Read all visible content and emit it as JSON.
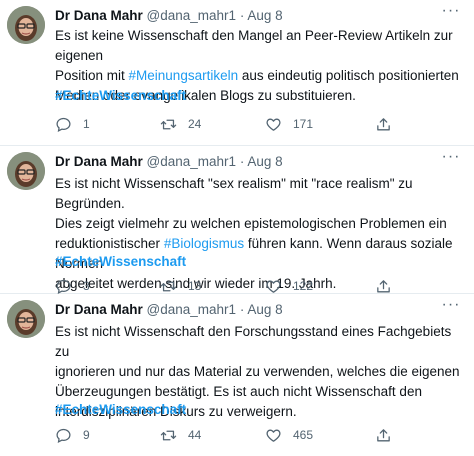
{
  "tweets": [
    {
      "author_name": "Dr Dana Mahr",
      "handle": "@dana_mahr1",
      "separator": "·",
      "date": "Aug 8",
      "text_lines": [
        [
          "Es ist keine Wissenschaft den Mangel an Peer-Review Artikeln zur eigenen"
        ],
        [
          "Position mit ",
          "#Meinungsartikeln",
          " aus eindeutig politisch positionierten"
        ],
        [
          "Medien oder evangelikalen Blogs zu substituieren."
        ]
      ],
      "hashtag": "#EchteWissenschaft",
      "replies": "1",
      "retweets": "24",
      "likes": "171"
    },
    {
      "author_name": "Dr Dana Mahr",
      "handle": "@dana_mahr1",
      "separator": "·",
      "date": "Aug 8",
      "text_lines": [
        [
          "Es ist nicht Wissenschaft \"sex realism\" mit \"race realism\" zu Begründen."
        ],
        [
          "Dies zeigt vielmehr zu welchen epistemologischen Problemen ein"
        ],
        [
          "reduktionistischer ",
          "#Biologismus",
          " führen kann. Wenn daraus soziale Normen"
        ],
        [
          "abgeleitet werden sind wir wieder im 19. Jahrh."
        ]
      ],
      "hashtag": "#EchteWissenschaft",
      "replies": "3",
      "retweets": "13",
      "likes": "122"
    },
    {
      "author_name": "Dr Dana Mahr",
      "handle": "@dana_mahr1",
      "separator": "·",
      "date": "Aug 8",
      "text_lines": [
        [
          "Es ist nicht Wissenschaft den Forschungsstand eines Fachgebiets zu"
        ],
        [
          "ignorieren und nur das Material zu verwenden, welches die eigenen"
        ],
        [
          "Überzeugungen bestätigt. Es ist auch nicht Wissenschaft den"
        ],
        [
          "interdisziplinären Diskurs zu verweigern."
        ]
      ],
      "hashtag": "#EchteWissenschaft",
      "replies": "9",
      "retweets": "44",
      "likes": "465"
    }
  ],
  "colors": {
    "link": "#1d9bf0",
    "text": "#0f1419",
    "muted": "#536471",
    "divider": "#e6ecf0"
  },
  "icons": {
    "more": "more-dots-icon",
    "reply": "reply-icon",
    "retweet": "retweet-icon",
    "like": "heart-icon",
    "share": "share-icon"
  }
}
